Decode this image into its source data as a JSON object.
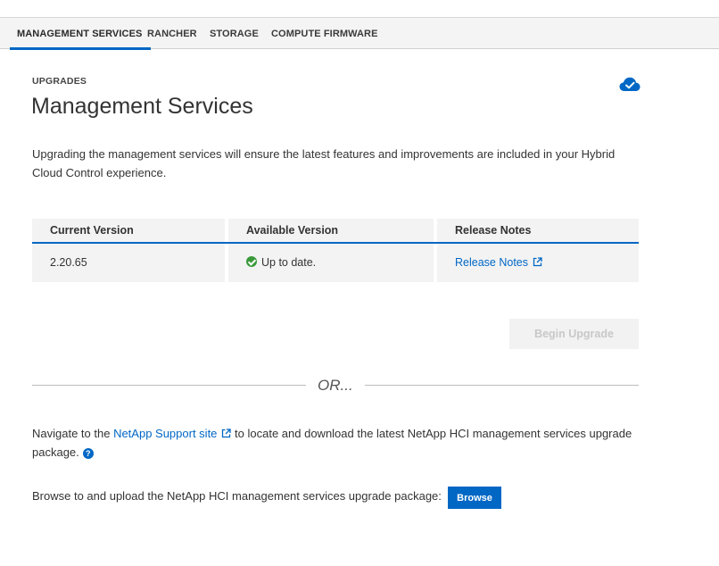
{
  "tabs": [
    {
      "label": "MANAGEMENT SERVICES",
      "active": true
    },
    {
      "label": "RANCHER",
      "active": false
    },
    {
      "label": "STORAGE",
      "active": false
    },
    {
      "label": "COMPUTE FIRMWARE",
      "active": false
    }
  ],
  "header": {
    "eyebrow": "UPGRADES",
    "title": "Management Services",
    "status_icon": "cloud-check-icon"
  },
  "description": "Upgrading the management services will ensure the latest features and improvements are included in your Hybrid Cloud Control experience.",
  "table": {
    "columns": [
      "Current Version",
      "Available Version",
      "Release Notes"
    ],
    "row": {
      "current_version": "2.20.65",
      "available_version": "Up to date.",
      "release_notes": "Release Notes"
    }
  },
  "begin_upgrade_label": "Begin Upgrade",
  "or_divider": "OR...",
  "navigate": {
    "prefix": "Navigate to the ",
    "link": "NetApp Support site",
    "suffix": " to locate and download the latest NetApp HCI management services upgrade package."
  },
  "browse": {
    "text": "Browse to and upload the NetApp HCI management services upgrade package:",
    "button": "Browse"
  },
  "colors": {
    "accent": "#0067c5",
    "success": "#3a9a3a"
  }
}
